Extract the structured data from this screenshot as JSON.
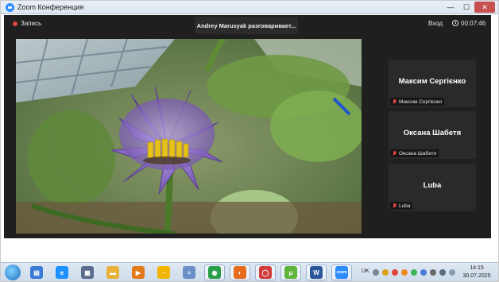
{
  "window": {
    "title": "Zoom Конференция",
    "minimize": "—",
    "maximize": "☐",
    "close": "✕"
  },
  "zoom": {
    "record_label": "Запись",
    "active_speaker": "Andrey Marusyak разговаривает...",
    "login_label": "Вход",
    "timer": "00:07:46"
  },
  "participants": [
    {
      "display": "Максим Сергієнко",
      "label": "Максим Сергієнко"
    },
    {
      "display": "Оксана Шабетя",
      "label": "Оксана Шабетя"
    },
    {
      "display": "Luba",
      "label": "Luba"
    }
  ],
  "taskbar": {
    "apps": [
      {
        "name": "explorer-folders",
        "color": "#3a7bd5",
        "glyph": "▤"
      },
      {
        "name": "internet-explorer",
        "color": "#1e90ff",
        "glyph": "e"
      },
      {
        "name": "save-disk",
        "color": "#5b6b8a",
        "glyph": "▦"
      },
      {
        "name": "file-explorer",
        "color": "#e8b23a",
        "glyph": "▬"
      },
      {
        "name": "media-player",
        "color": "#e27a1b",
        "glyph": "▶"
      },
      {
        "name": "chrome-yellow",
        "color": "#f2b600",
        "glyph": "◔"
      },
      {
        "name": "notes",
        "color": "#6a8fc4",
        "glyph": "≡"
      },
      {
        "name": "chrome",
        "color": "#2a9d4a",
        "glyph": "◉"
      },
      {
        "name": "firefox",
        "color": "#e76b1d",
        "glyph": "◐"
      },
      {
        "name": "opera",
        "color": "#d03a3a",
        "glyph": "◯"
      },
      {
        "name": "utorrent",
        "color": "#5fb43a",
        "glyph": "μ"
      },
      {
        "name": "word",
        "color": "#2b579a",
        "glyph": "W"
      },
      {
        "name": "zoom",
        "color": "#2d8cff",
        "glyph": "zoom"
      }
    ],
    "language": "UK",
    "clock_time": "14:15",
    "clock_date": "30.07.2025"
  }
}
